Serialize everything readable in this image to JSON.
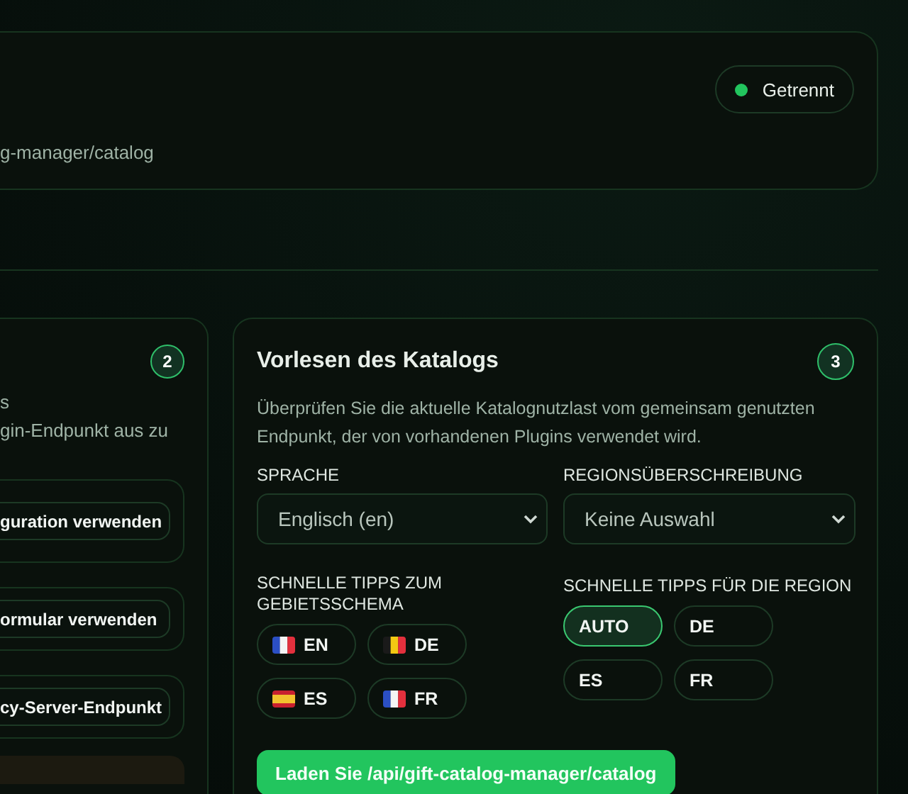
{
  "connection": {
    "endpoint": "g-manager/catalog",
    "status": {
      "label": "Getrennt",
      "color": "#22c55e"
    }
  },
  "left_panel": {
    "step": "2",
    "description_lines": [
      "s",
      "gin-Endpunkt aus zu"
    ],
    "options": [
      {
        "button": "guration verwenden"
      },
      {
        "button": "ormular verwenden"
      },
      {
        "button": "cy-Server-Endpunkt"
      }
    ]
  },
  "catalog_panel": {
    "title": "Vorlesen des Katalogs",
    "step": "3",
    "description": "Überprüfen Sie die aktuelle Katalognutzlast vom gemeinsam genutzten Endpunkt, der von vorhandenen Plugins verwendet wird.",
    "language": {
      "label": "SPRACHE",
      "value": "Englisch (en)"
    },
    "region": {
      "label": "REGIONSÜBERSCHREIBUNG",
      "value": "Keine Auswahl"
    },
    "locale_tips": {
      "label": "SCHNELLE TIPPS ZUM GEBIETSSCHEMA",
      "chips": [
        {
          "label": "EN",
          "kind": "fr"
        },
        {
          "label": "DE",
          "kind": "be"
        },
        {
          "label": "ES",
          "kind": "es"
        },
        {
          "label": "FR",
          "kind": "fr"
        }
      ]
    },
    "region_tips": {
      "label": "SCHNELLE TIPPS FÜR DIE REGION",
      "chips": [
        {
          "label": "AUTO",
          "selected": true
        },
        {
          "label": "DE",
          "selected": false
        },
        {
          "label": "ES",
          "selected": false
        },
        {
          "label": "FR",
          "selected": false
        }
      ]
    },
    "load_button": "Laden Sie /api/gift-catalog-manager/catalog"
  }
}
